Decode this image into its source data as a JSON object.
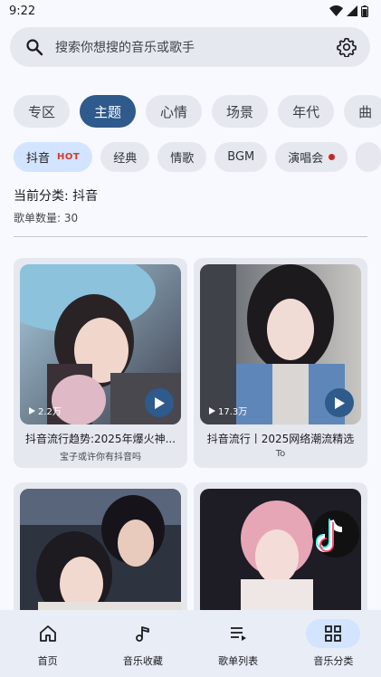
{
  "status_bar": {
    "time": "9:22"
  },
  "search": {
    "placeholder": "搜索你想搜的音乐或歌手"
  },
  "tabs": [
    {
      "label": "专区",
      "active": false
    },
    {
      "label": "主题",
      "active": true
    },
    {
      "label": "心情",
      "active": false
    },
    {
      "label": "场景",
      "active": false
    },
    {
      "label": "年代",
      "active": false
    },
    {
      "label": "曲",
      "active": false
    }
  ],
  "chips": [
    {
      "label": "抖音",
      "badge": "HOT",
      "active": true
    },
    {
      "label": "经典"
    },
    {
      "label": "情歌"
    },
    {
      "label": "BGM"
    },
    {
      "label": "演唱会",
      "dot": true
    },
    {
      "label": ""
    }
  ],
  "category": {
    "title": "当前分类: 抖音",
    "count": "歌单数量: 30"
  },
  "playlists": [
    {
      "title": "抖音流行趋势:2025年爆火神...",
      "subtitle": "宝子或许你有抖音吗",
      "plays": "2.2万"
    },
    {
      "title": "抖音流行丨2025网络潮流精选",
      "subtitle": "To",
      "plays": "17.3万"
    },
    {
      "title": "",
      "subtitle": "",
      "plays": ""
    },
    {
      "title": "",
      "subtitle": "",
      "plays": ""
    }
  ],
  "bottom_nav": [
    {
      "label": "首页",
      "icon": "home-icon",
      "active": false
    },
    {
      "label": "音乐收藏",
      "icon": "music-note-icon",
      "active": false
    },
    {
      "label": "歌单列表",
      "icon": "playlist-icon",
      "active": false
    },
    {
      "label": "音乐分类",
      "icon": "grid-icon",
      "active": true
    }
  ],
  "colors": {
    "accent": "#2e5a8c",
    "chip_active": "#d2e4ff",
    "surface": "#e5e8ef",
    "hot": "#d33a2f"
  }
}
